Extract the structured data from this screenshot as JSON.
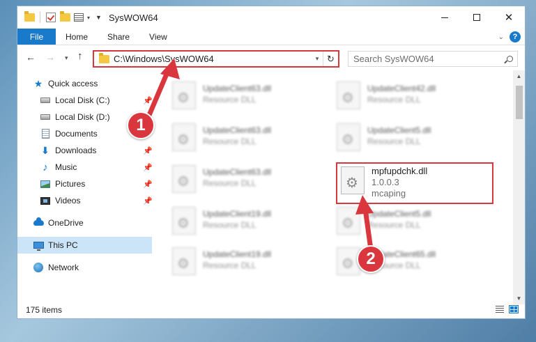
{
  "window": {
    "title": "SysWOW64"
  },
  "ribbon": {
    "tabs": [
      "File",
      "Home",
      "Share",
      "View"
    ],
    "help_label": "?"
  },
  "nav": {
    "address": "C:\\Windows\\SysWOW64",
    "search_placeholder": "Search SysWOW64"
  },
  "sidebar": {
    "items": [
      {
        "label": "Quick access",
        "icon": "star-icon"
      },
      {
        "label": "Local Disk (C:)",
        "icon": "drive-icon"
      },
      {
        "label": "Local Disk (D:)",
        "icon": "drive-icon"
      },
      {
        "label": "Documents",
        "icon": "documents-icon"
      },
      {
        "label": "Downloads",
        "icon": "download-icon"
      },
      {
        "label": "Music",
        "icon": "music-icon"
      },
      {
        "label": "Pictures",
        "icon": "pictures-icon"
      },
      {
        "label": "Videos",
        "icon": "videos-icon"
      },
      {
        "label": "OneDrive",
        "icon": "cloud-icon"
      },
      {
        "label": "This PC",
        "icon": "pc-icon"
      },
      {
        "label": "Network",
        "icon": "network-icon"
      }
    ]
  },
  "files": {
    "left_column": [
      {
        "name": "UpdateClient63.dll",
        "type": "Resource DLL"
      },
      {
        "name": "UpdateClient63.dll",
        "type": "Resource DLL"
      },
      {
        "name": "UpdateClient63.dll",
        "type": "Resource DLL"
      },
      {
        "name": "UpdateClient19.dll",
        "type": "Resource DLL"
      },
      {
        "name": "UpdateClient19.dll",
        "type": "Resource DLL"
      }
    ],
    "right_column": [
      {
        "name": "UpdateClient42.dll",
        "type": "Resource DLL"
      },
      {
        "name": "UpdateClient5.dll",
        "type": "Resource DLL"
      },
      {
        "name": "UpdateClient5.dll",
        "type": "Resource DLL"
      },
      {
        "name": "UpdateClient65.dll",
        "type": "Resource DLL"
      }
    ],
    "focused": {
      "name": "mpfupdchk.dll",
      "version": "1.0.0.3",
      "company": "mcaping"
    }
  },
  "status": {
    "item_count": "175 items"
  },
  "annotations": {
    "step1": "1",
    "step2": "2",
    "highlight_color": "#d9363e"
  }
}
